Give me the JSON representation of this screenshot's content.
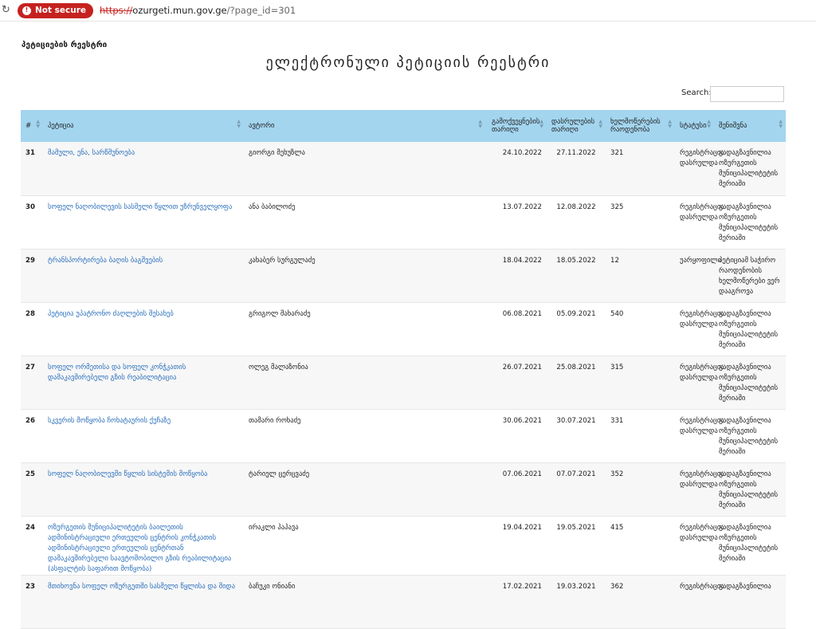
{
  "browser": {
    "security_label": "Not secure",
    "url_scheme": "https://",
    "url_host": "ozurgeti.mun.gov.ge",
    "url_path": "/?page_id=301"
  },
  "page": {
    "breadcrumb": "პეტიციების რეესტრი",
    "title": "ელექტრონული პეტიციის რეესტრი",
    "search_label": "Search:",
    "search_value": ""
  },
  "table": {
    "headers": [
      "#",
      "პეტიცია",
      "ავტორი",
      "გამოქვეყნების თარიღი",
      "დასრულების თარიღი",
      "ხელმოწერების რაოდენობა",
      "სტატუსი",
      "შენიშვნა"
    ],
    "rows": [
      {
        "num": "31",
        "title": "მამული, ენა, სარწმუნოება",
        "author": "გიორგი მეხუზლა",
        "published": "24.10.2022",
        "ended": "27.11.2022",
        "signatures": "321",
        "status": "რეგისტრაცია დასრულდა",
        "note": "გადაგზავნილია ოზურგეთის მუნიციპალიტეტის მერიაში"
      },
      {
        "num": "30",
        "title": "სოფელ ნაღობილევის სასმელი წყლით უზრუნველყოფა",
        "author": "ანა ბაბილოძე",
        "published": "13.07.2022",
        "ended": "12.08.2022",
        "signatures": "325",
        "status": "რეგისტრაცია დასრულდა",
        "note": "გადაგზავნილია ოზურგეთის მუნიციპალიტეტის მერიაში"
      },
      {
        "num": "29",
        "title": "ტრანსპორტირება ბაღის ბაგშვების",
        "author": "კახაბერ სურგულაძე",
        "published": "18.04.2022",
        "ended": "18.05.2022",
        "signatures": "12",
        "status": "უარყოფილი",
        "note": "პეტიციამ საჭირო რაოდენობის ხელმოწერები ვერ დააგროვა"
      },
      {
        "num": "28",
        "title": "პეტიცია უპატრონო ძაღლების შესახებ",
        "author": "გრიგოლ მახარაძე",
        "published": "06.08.2021",
        "ended": "05.09.2021",
        "signatures": "540",
        "status": "რეგისტრაცია დასრულდა",
        "note": "გადაგზავნილია ოზურგეთის მუნიციპალიტეტის მერიაში"
      },
      {
        "num": "27",
        "title": "სოფელ ორმეთისა და სოფელ კონჭკათის დამაკავშირებელი გზის რეაბილიტაცია",
        "author": "ოლეგ მალაზონია",
        "published": "26.07.2021",
        "ended": "25.08.2021",
        "signatures": "315",
        "status": "რეგისტრაცია დასრულდა",
        "note": "გადაგზავნილია ოზურგეთის მუნიციპალიტეტის მერიაში"
      },
      {
        "num": "26",
        "title": "სკვერის მოწყობა ჩოხატაურის ქუჩაზე",
        "author": "თამარი როხაძე",
        "published": "30.06.2021",
        "ended": "30.07.2021",
        "signatures": "331",
        "status": "რეგისტრაცია დასრულდა",
        "note": "გადაგზავნილია ოზურგეთის მუნიციპალიტეტის მერიაში"
      },
      {
        "num": "25",
        "title": "სოფელ ნაღობილევში წყლის სისტემის მოწყობა",
        "author": "ტარიელ ცერცვაძე",
        "published": "07.06.2021",
        "ended": "07.07.2021",
        "signatures": "352",
        "status": "რეგისტრაცია დასრულდა",
        "note": "გადაგზავნილია ოზურგეთის მუნიციპალიტეტის მერიაში"
      },
      {
        "num": "24",
        "title": "ოზურგეთის მუნიციპალიტეტის ბაილეთის ადმინისტრაციული ერთეულის ცენტრის კონჭკათის ადმინისტრაციული ერთეულის ცენტრთან დამაკავშირებელი საავტომობილო გზის რეაბილიტაცია (ასფალტის საფარით მოწყობა)",
        "author": "ირაკლი პაპავა",
        "published": "19.04.2021",
        "ended": "19.05.2021",
        "signatures": "415",
        "status": "რეგისტრაცია დასრულდა",
        "note": "გადაგზავნილია ოზურგეთის მუნიციპალიტეტის მერიაში"
      },
      {
        "num": "23",
        "title": "მთიხოვნა სოფელ ოზურგეთში სასმელი წყლისა და მიდა",
        "author": "ბაჩუკი ონიანი",
        "published": "17.02.2021",
        "ended": "19.03.2021",
        "signatures": "362",
        "status": "რეგისტრაცია",
        "note": "გადაგზავნილია"
      }
    ]
  }
}
